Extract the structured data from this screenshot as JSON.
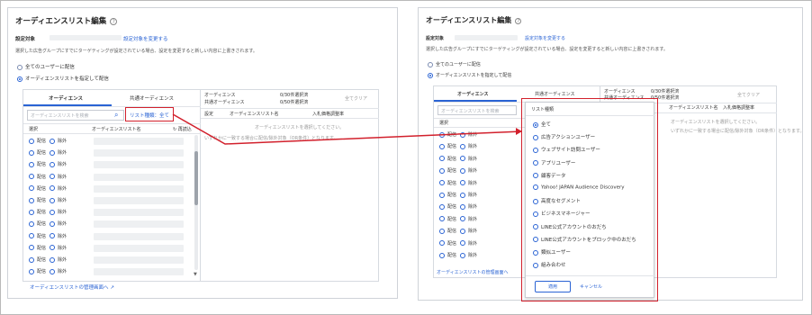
{
  "left": {
    "title": "オーディエンスリスト編集",
    "help": "?",
    "target_label": "設定対象",
    "change_target_link": "設定対象を変更する",
    "note": "選択した広告グループにすでにターゲティングが設定されている場合、設定を変更すると新しい内容に上書きされます。",
    "radio_all_users": "全てのユーザーに配信",
    "radio_specify": "オーディエンスリストを指定して配信",
    "tabs": [
      "オーディエンス",
      "共通オーディエンス"
    ],
    "search_placeholder": "オーディエンスリストを検索",
    "list_type_filter": "リスト種類：全て",
    "col_select": "選択",
    "col_name": "オーディエンスリスト名",
    "reload": "再読込",
    "deliver": "配信",
    "exclude": "除外",
    "selected_box": {
      "audience_label": "オーディエンス",
      "common_label": "共通オーディエンス",
      "audience_count": "0/30件選択済",
      "common_count": "0/50件選択済",
      "clear_all": "全てクリア",
      "col_setting": "設定",
      "col_list_name": "オーディエンスリスト名",
      "col_bid": "入札価格調整率",
      "empty_msg": "オーディエンスリストを選択してください。",
      "or_msg": "いずれかに一致する場合に配信/除外対象（OR条件）となります。"
    },
    "manage_link": "オーディエンスリストの管理画面へ"
  },
  "right": {
    "title": "オーディエンスリスト編集",
    "help": "?",
    "target_label": "設定対象",
    "change_target_link": "設定対象を変更する",
    "note": "選択した広告グループにすでにターゲティングが設定されている場合、設定を変更すると新しい内容に上書きされます。",
    "radio_all_users": "全てのユーザーに配信",
    "radio_specify": "オーディエンスリストを指定して配信",
    "tabs": [
      "オーディエンス",
      "共通オーディエンス"
    ],
    "search_placeholder": "オーディエンスリストを検索",
    "col_select": "選択",
    "deliver": "配信",
    "exclude": "除外",
    "selected_box": {
      "audience_label": "オーディエンス",
      "common_label": "共通オーディエンス",
      "audience_count": "0/30件選択済",
      "common_count": "0/50件選択済",
      "clear_all": "全てクリア",
      "col_list_name": "オーディエンスリスト名",
      "col_bid": "入札価格調整率",
      "empty_msg": "オーディエンスリストを選択してください。",
      "or_msg": "いずれかに一致する場合に配信/除外対象（OR条件）となります。"
    },
    "manage_link": "オーディエンスリストの管理画面へ",
    "dropdown": {
      "header": "リスト種類",
      "options": [
        "全て",
        "広告アクションユーザー",
        "ウェブサイト訪問ユーザー",
        "アプリユーザー",
        "顧客データ",
        "Yahoo! JAPAN Audience Discovery",
        "高度なセグメント",
        "ビジネスマネージャー",
        "LINE公式アカウントのおだち",
        "LINE公式アカウントをブロック中のおだち",
        "類似ユーザー",
        "組み合わせ"
      ],
      "selected_index": 0,
      "apply": "適用",
      "cancel": "キャンセル"
    }
  },
  "colors": {
    "accent": "#2a63d4",
    "highlight_red": "#d2202c"
  }
}
